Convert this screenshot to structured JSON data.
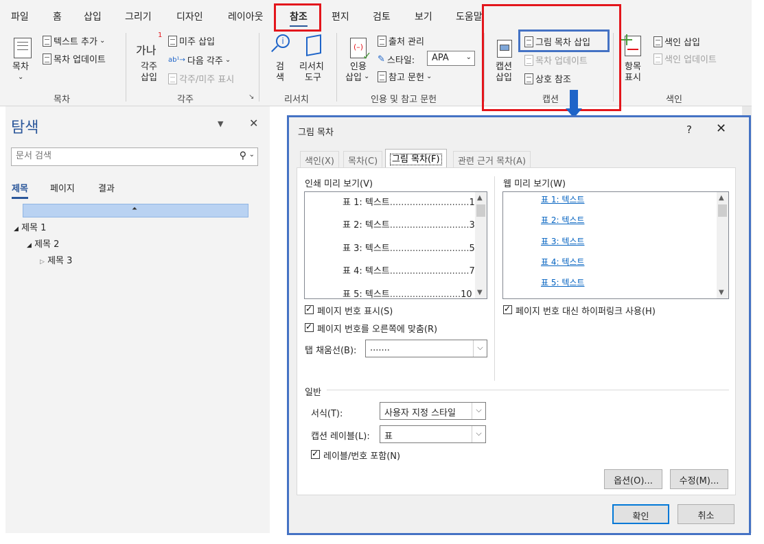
{
  "ribbon": {
    "tabs": [
      "파일",
      "홈",
      "삽입",
      "그리기",
      "디자인",
      "레이아웃",
      "참조",
      "편지",
      "검토",
      "보기",
      "도움말"
    ],
    "active_tab": "참조",
    "groups": {
      "toc": {
        "label": "목차",
        "big_button": "목차",
        "add_text": "텍스트 추가",
        "update_toc": "목차 업데이트"
      },
      "footnotes": {
        "label": "각주",
        "big_glyph": "가나",
        "big_button_line1": "각주",
        "big_button_line2": "삽입",
        "insert_endnote": "미주 삽입",
        "next_footnote": "다음 각주",
        "show_notes": "각주/미주 표시"
      },
      "research": {
        "label": "리서치",
        "search_line1": "검",
        "search_line2": "색",
        "researcher_line1": "리서치",
        "researcher_line2": "도구"
      },
      "citations": {
        "label": "인용 및 참고 문헌",
        "insert_citation_line1": "인용",
        "insert_citation_line2": "삽입",
        "manage_sources": "출처 관리",
        "style_label": "스타일:",
        "style_value": "APA",
        "bibliography": "참고 문헌"
      },
      "captions": {
        "label": "캡션",
        "insert_caption_line1": "캡션",
        "insert_caption_line2": "삽입",
        "insert_tof": "그림 목차 삽입",
        "update_table": "목차 업데이트",
        "cross_reference": "상호 참조"
      },
      "index": {
        "label": "색인",
        "mark_entry_line1": "항목",
        "mark_entry_line2": "표시",
        "insert_index": "색인 삽입",
        "update_index": "색인 업데이트"
      }
    }
  },
  "nav_pane": {
    "title": "탐색",
    "search_placeholder": "문서 검색",
    "tabs": [
      "제목",
      "페이지",
      "결과"
    ],
    "tree": [
      "제목 1",
      "제목 2",
      "제목 3"
    ]
  },
  "dialog": {
    "title": "그림 목차",
    "help": "?",
    "close": "✕",
    "tabs": [
      "색인(X)",
      "목차(C)",
      "그림 목차(F)",
      "관련 근거 목차(A)"
    ],
    "print_preview_label": "인쇄 미리 보기(V)",
    "print_preview_rows": [
      {
        "label": "표 1: 텍스트",
        "page": "1"
      },
      {
        "label": "표 2: 텍스트",
        "page": "3"
      },
      {
        "label": "표 3: 텍스트",
        "page": "5"
      },
      {
        "label": "표 4: 텍스트",
        "page": "7"
      },
      {
        "label": "표 5: 텍스트",
        "page": "10"
      }
    ],
    "web_preview_label": "웹 미리 보기(W)",
    "web_preview_rows": [
      "표 1: 텍스트",
      "표 2: 텍스트",
      "표 3: 텍스트",
      "표 4: 텍스트",
      "표 5: 텍스트"
    ],
    "show_page_numbers": "페이지 번호 표시(S)",
    "right_align": "페이지 번호를 오른쪽에 맞춤(R)",
    "tab_leader_label": "탭 채움선(B):",
    "tab_leader_value": ".......",
    "use_hyperlinks": "페이지 번호 대신 하이퍼링크 사용(H)",
    "general_label": "일반",
    "format_label": "서식(T):",
    "format_value": "사용자 지정 스타일",
    "caption_label_label": "캡션 레이블(L):",
    "caption_label_value": "표",
    "include_label": "레이블/번호 포함(N)",
    "options_button": "옵션(O)...",
    "modify_button": "수정(M)...",
    "ok_button": "확인",
    "cancel_button": "취소",
    "checked": {
      "show_page_numbers": true,
      "right_align": true,
      "use_hyperlinks": true,
      "include_label": true
    }
  },
  "colors": {
    "highlight_red": "#e3151b",
    "highlight_blue": "#4472c4",
    "arrow_blue": "#1e64c8",
    "link_blue": "#0563c1"
  }
}
